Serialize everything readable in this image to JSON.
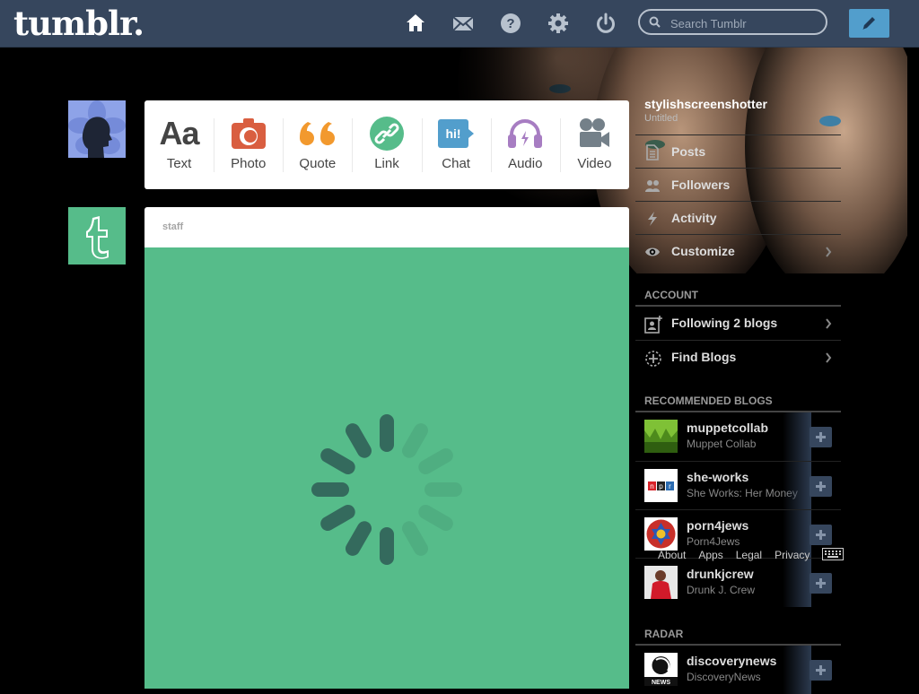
{
  "header": {
    "logo": "tumblr.",
    "search_placeholder": "Search Tumblr",
    "icons": [
      "home-icon",
      "mail-icon",
      "help-icon",
      "gear-icon",
      "power-icon"
    ],
    "compose_icon": "pencil-icon"
  },
  "post_types": [
    {
      "label": "Text",
      "icon": "text-icon",
      "color": "#444444"
    },
    {
      "label": "Photo",
      "icon": "camera-icon",
      "color": "#d95e40"
    },
    {
      "label": "Quote",
      "icon": "quote-icon",
      "color": "#f2992e"
    },
    {
      "label": "Link",
      "icon": "link-icon",
      "color": "#56bc8a"
    },
    {
      "label": "Chat",
      "icon": "chat-icon",
      "color": "#529ecc"
    },
    {
      "label": "Audio",
      "icon": "headphones-icon",
      "color": "#a77dc2"
    },
    {
      "label": "Video",
      "icon": "video-camera-icon",
      "color": "#748089"
    }
  ],
  "post": {
    "author": "staff",
    "background": "#56bc8a"
  },
  "sidebar": {
    "blog_name": "stylishscreenshotter",
    "blog_title": "Untitled",
    "blog_items": [
      {
        "label": "Posts",
        "icon": "document-icon"
      },
      {
        "label": "Followers",
        "icon": "followers-icon"
      },
      {
        "label": "Activity",
        "icon": "activity-icon"
      },
      {
        "label": "Customize",
        "icon": "eye-icon"
      }
    ],
    "account_heading": "ACCOUNT",
    "account_items": [
      {
        "label": "Following 2 blogs",
        "icon": "following-icon"
      },
      {
        "label": "Find Blogs",
        "icon": "find-blogs-icon"
      }
    ],
    "recommended_heading": "RECOMMENDED BLOGS",
    "recommended": [
      {
        "name": "muppetcollab",
        "title": "Muppet Collab"
      },
      {
        "name": "she-works",
        "title": "She Works: Her Money"
      },
      {
        "name": "porn4jews",
        "title": "Porn4Jews"
      },
      {
        "name": "drunkjcrew",
        "title": "Drunk J. Crew"
      }
    ],
    "footer_links": [
      "About",
      "Apps",
      "Legal",
      "Privacy"
    ],
    "radar_heading": "RADAR",
    "radar": [
      {
        "name": "discoverynews",
        "title": "DiscoveryNews"
      }
    ]
  },
  "colors": {
    "header": "#36465d",
    "compose": "#529ecc",
    "accent_green": "#56bc8a"
  }
}
